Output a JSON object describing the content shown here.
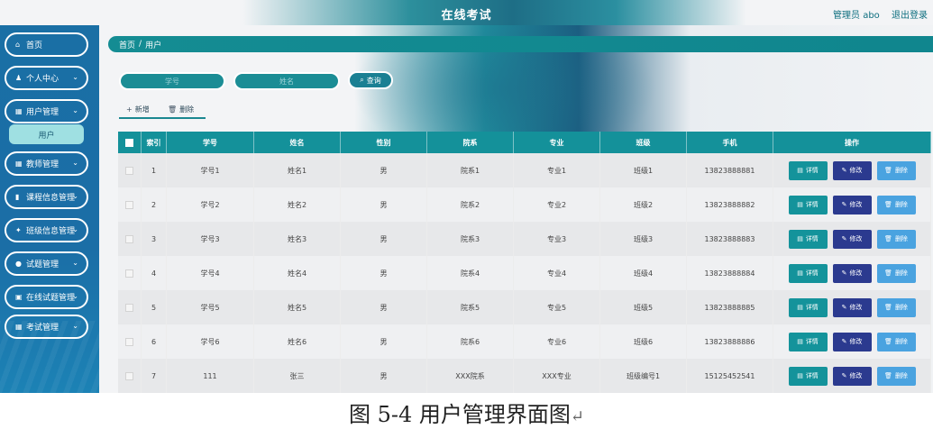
{
  "header": {
    "title": "在线考试",
    "admin_label": "管理员 abo",
    "logout_label": "退出登录"
  },
  "sidebar": {
    "items": [
      {
        "label": "首页",
        "icon": "home-icon",
        "glyph": "⌂",
        "has_chevron": false
      },
      {
        "label": "个人中心",
        "icon": "user-icon",
        "glyph": "♟",
        "has_chevron": true
      },
      {
        "label": "用户管理",
        "icon": "grid-icon",
        "glyph": "▦",
        "has_chevron": true
      },
      {
        "label": "教师管理",
        "icon": "grid-icon",
        "glyph": "▦",
        "has_chevron": true
      },
      {
        "label": "课程信息管理",
        "icon": "book-icon",
        "glyph": "▮",
        "has_chevron": true
      },
      {
        "label": "班级信息管理",
        "icon": "thumb-icon",
        "glyph": "✦",
        "has_chevron": true
      },
      {
        "label": "试题管理",
        "icon": "pin-icon",
        "glyph": "●",
        "has_chevron": true
      },
      {
        "label": "在线试题管理",
        "icon": "list-icon",
        "glyph": "▣",
        "has_chevron": true
      },
      {
        "label": "考试管理",
        "icon": "grid-icon",
        "glyph": "▦",
        "has_chevron": true
      }
    ],
    "sub_item": "用户",
    "chevron": "⌄"
  },
  "breadcrumb": {
    "home": "首页",
    "separator": "/",
    "current": "用户"
  },
  "search": {
    "student_id_value": "学号",
    "name_placeholder": "姓名",
    "button_label": "查询",
    "button_icon": "⌕"
  },
  "actions": {
    "add_label": "新增",
    "add_icon": "+",
    "delete_label": "删除",
    "delete_icon": "🗑"
  },
  "table": {
    "columns": [
      "索引",
      "学号",
      "姓名",
      "性别",
      "院系",
      "专业",
      "班级",
      "手机",
      "操作"
    ],
    "rows": [
      [
        "1",
        "学号1",
        "姓名1",
        "男",
        "院系1",
        "专业1",
        "班级1",
        "13823888881"
      ],
      [
        "2",
        "学号2",
        "姓名2",
        "男",
        "院系2",
        "专业2",
        "班级2",
        "13823888882"
      ],
      [
        "3",
        "学号3",
        "姓名3",
        "男",
        "院系3",
        "专业3",
        "班级3",
        "13823888883"
      ],
      [
        "4",
        "学号4",
        "姓名4",
        "男",
        "院系4",
        "专业4",
        "班级4",
        "13823888884"
      ],
      [
        "5",
        "学号5",
        "姓名5",
        "男",
        "院系5",
        "专业5",
        "班级5",
        "13823888885"
      ],
      [
        "6",
        "学号6",
        "姓名6",
        "男",
        "院系6",
        "专业6",
        "班级6",
        "13823888886"
      ],
      [
        "7",
        "111",
        "张三",
        "男",
        "XXX院系",
        "XXX专业",
        "班级编号1",
        "15125452541"
      ]
    ],
    "op_detail": "详情",
    "op_detail_icon": "▤",
    "op_edit": "修改",
    "op_edit_icon": "✎",
    "op_delete": "删除",
    "op_delete_icon": "🗑"
  },
  "caption": {
    "text": "图 5-4 用户管理界面图",
    "return_mark": "↵"
  },
  "colors": {
    "accent": "#14919a",
    "sidebar": "#1a6fa5",
    "edit": "#2b3a8f",
    "delete": "#4aa3e0"
  }
}
